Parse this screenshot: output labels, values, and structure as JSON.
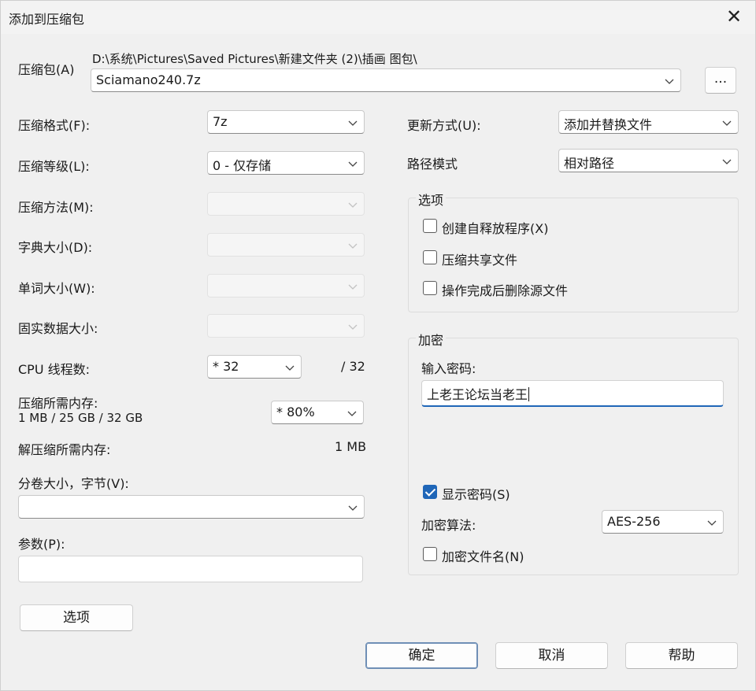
{
  "window": {
    "title": "添加到压缩包",
    "close": "✕"
  },
  "archive": {
    "label": "压缩包(A)",
    "path": "D:\\系统\\Pictures\\Saved Pictures\\新建文件夹 (2)\\插画 图包\\",
    "filename": "Sciamano240.7z",
    "browse_label": "..."
  },
  "left": {
    "format": {
      "label": "压缩格式(F):",
      "value": "7z"
    },
    "level": {
      "label": "压缩等级(L):",
      "value": "0 - 仅存储"
    },
    "method": {
      "label": "压缩方法(M):",
      "value": ""
    },
    "dict": {
      "label": "字典大小(D):",
      "value": ""
    },
    "word": {
      "label": "单词大小(W):",
      "value": ""
    },
    "solid": {
      "label": "固实数据大小:",
      "value": ""
    },
    "threads": {
      "label": "CPU 线程数:",
      "value": "* 32",
      "max": "/ 32"
    },
    "mem_compress": {
      "label": "压缩所需内存:",
      "detail": "1 MB / 25 GB / 32 GB",
      "value": "* 80%"
    },
    "mem_decompress": {
      "label": "解压缩所需内存:",
      "value": "1 MB"
    },
    "volume": {
      "label": "分卷大小，字节(V):",
      "value": ""
    },
    "params": {
      "label": "参数(P):",
      "value": ""
    },
    "options_button": "选项"
  },
  "right": {
    "update": {
      "label": "更新方式(U):",
      "value": "添加并替换文件"
    },
    "path_mode": {
      "label": "路径模式",
      "value": "相对路径"
    },
    "options_group": {
      "title": "选项",
      "sfx": {
        "label": "创建自释放程序(X)",
        "checked": false
      },
      "shared": {
        "label": "压缩共享文件",
        "checked": false
      },
      "delete": {
        "label": "操作完成后删除源文件",
        "checked": false
      }
    },
    "encryption_group": {
      "title": "加密",
      "password_label": "输入密码:",
      "password_value": "上老王论坛当老王",
      "show_password": {
        "label": "显示密码(S)",
        "checked": true
      },
      "method_label": "加密算法:",
      "method_value": "AES-256",
      "encrypt_names": {
        "label": "加密文件名(N)",
        "checked": false
      }
    }
  },
  "buttons": {
    "ok": "确定",
    "cancel": "取消",
    "help": "帮助"
  }
}
